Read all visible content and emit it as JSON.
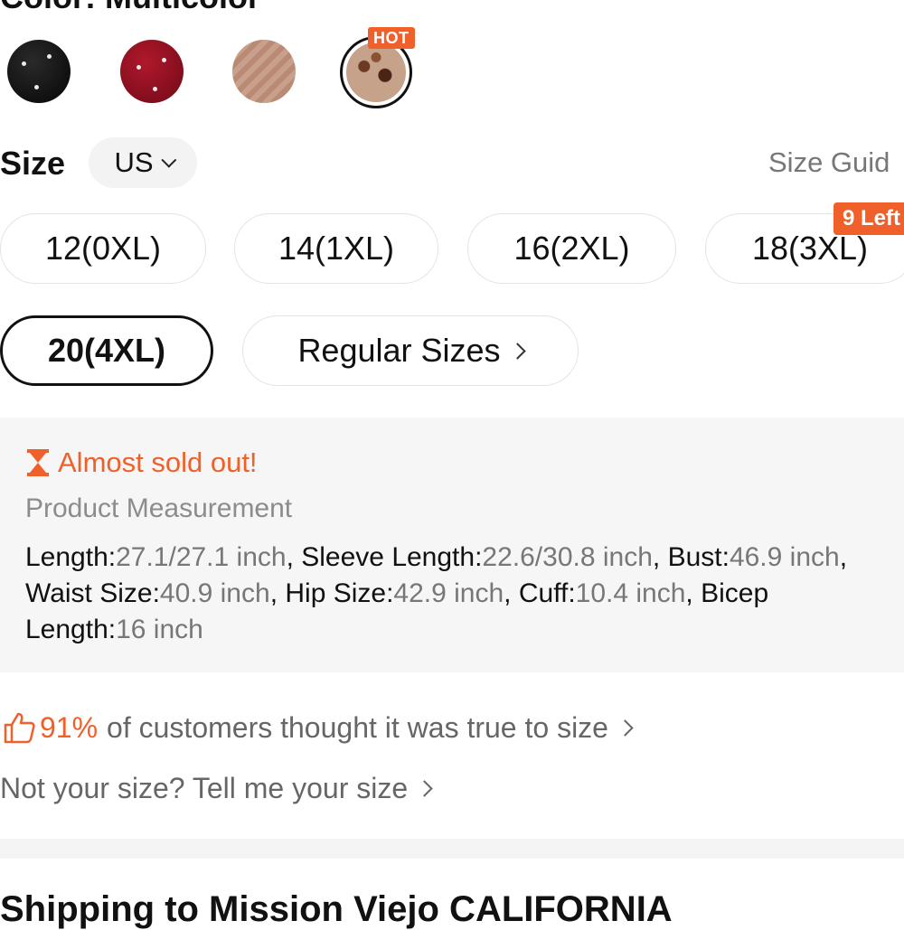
{
  "color": {
    "label_cut": "Color: Multicolor",
    "hot_badge": "HOT",
    "swatches": [
      "black",
      "red",
      "pink",
      "leopard"
    ]
  },
  "size": {
    "title": "Size",
    "unit": "US",
    "guide": "Size Guid",
    "options": [
      "12(0XL)",
      "14(1XL)",
      "16(2XL)",
      "18(3XL)",
      "20(4XL)"
    ],
    "selected": "20(4XL)",
    "left_badge": "9 Left",
    "regular_sizes": "Regular Sizes"
  },
  "measurement": {
    "alert": "Almost sold out!",
    "title": "Product Measurement",
    "items": [
      {
        "label": "Length:",
        "value": "27.1/27.1 inch"
      },
      {
        "label": "Sleeve Length:",
        "value": "22.6/30.8 inch"
      },
      {
        "label": "Bust:",
        "value": "46.9 inch"
      },
      {
        "label": "Waist Size:",
        "value": "40.9 inch"
      },
      {
        "label": "Hip Size:",
        "value": "42.9 inch"
      },
      {
        "label": "Cuff:",
        "value": "10.4 inch"
      },
      {
        "label": "Bicep Length:",
        "value": "16 inch"
      }
    ]
  },
  "fit": {
    "percent": "91%",
    "text": "of customers thought it was true to size"
  },
  "not_your_size": "Not your size? Tell me your size",
  "shipping_cut": "Shipping to Mission Viejo CALIFORNIA",
  "colors": {
    "accent": "#f0602a",
    "panel": "#f6f6f6"
  }
}
